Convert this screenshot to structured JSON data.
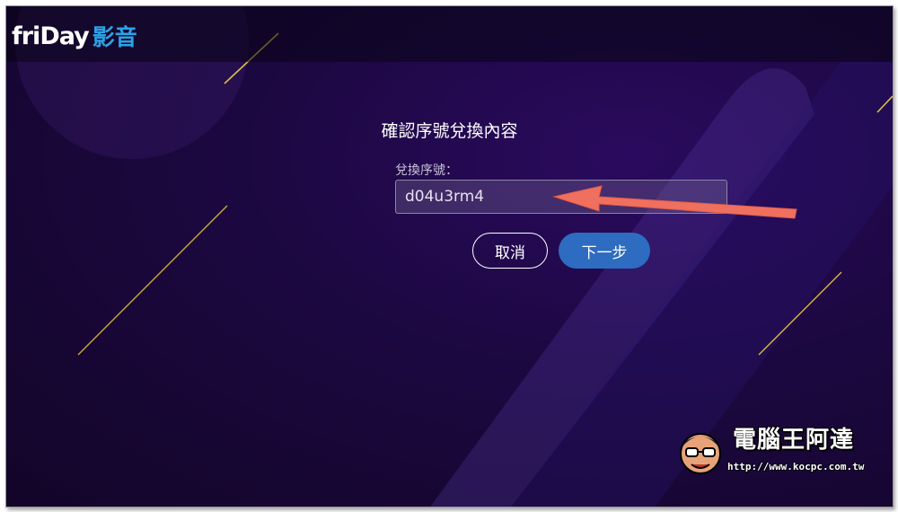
{
  "brand": {
    "logo_text": "friDay",
    "logo_suffix": "影音",
    "accent_color": "#2aa3e8"
  },
  "dialog": {
    "title": "確認序號兌換內容",
    "field_label": "兌換序號：",
    "field_value": "d04u3rm4",
    "cancel_label": "取消",
    "next_label": "下一步",
    "next_color": "#2d6cc0"
  },
  "watermark": {
    "title": "電腦王阿達",
    "url": "http://www.kocpc.com.tw",
    "face_icon": "cartoon-face-icon"
  },
  "annotation": {
    "arrow_icon": "red-arrow-icon",
    "arrow_color": "#f07060"
  }
}
